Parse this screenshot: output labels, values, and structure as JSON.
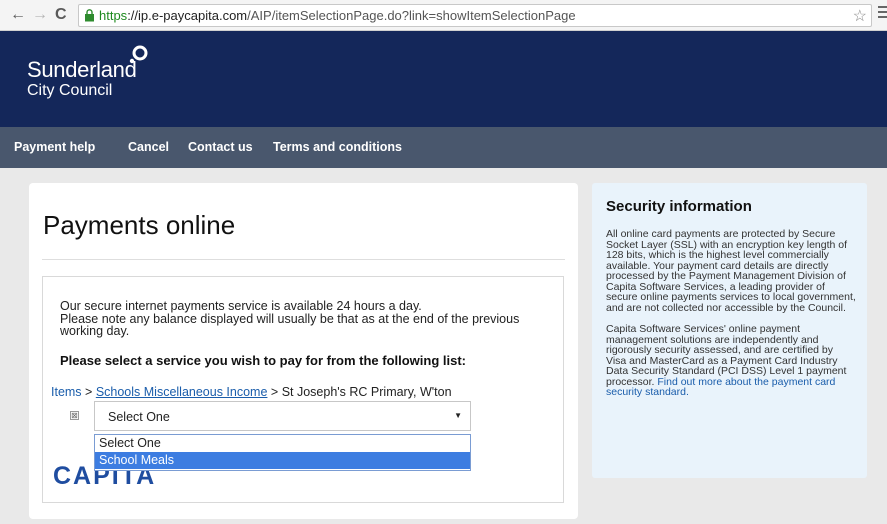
{
  "browser": {
    "back": "←",
    "forward": "→",
    "reload": "C",
    "url_scheme": "https",
    "url_host": "://ip.e-paycapita.com",
    "url_path": "/AIP/itemSelectionPage.do?link=showItemSelectionPage",
    "star": "☆"
  },
  "header": {
    "logo_line1": "Sunderland",
    "logo_line2": "City Council"
  },
  "nav": {
    "payment_help": "Payment help",
    "cancel": "Cancel",
    "contact_us": "Contact us",
    "terms": "Terms and conditions"
  },
  "main": {
    "title": "Payments online",
    "intro_line1": "Our secure internet payments service is available 24 hours a day.",
    "intro_line2": "Please note any balance displayed will usually be that as at the end of the previous working day.",
    "prompt": "Please select a service you wish to pay for from the following list:",
    "breadcrumb": {
      "items": "Items",
      "sep": " > ",
      "category": "Schools Miscellaneous Income",
      "current": "St Joseph's RC Primary, W'ton"
    },
    "expand_glyph": "⊠",
    "select": {
      "value": "Select One",
      "arrow": "▼",
      "options": [
        "Select One",
        "School Meals"
      ],
      "highlighted": "School Meals"
    },
    "capita": "CAPITA"
  },
  "security": {
    "title": "Security information",
    "para1": "All online card payments are protected by Secure Socket Layer (SSL) with an encryption key length of 128 bits, which is the highest level commercially available. Your payment card details are directly processed by the Payment Management Division of Capita Software Services, a leading provider of secure online payments services to local government, and are not collected nor accessible by the Council.",
    "para2": "Capita Software Services' online payment management solutions are independently and rigorously security assessed, and are certified by Visa and MasterCard as a Payment Card Industry Data Security Standard (PCI DSS) Level 1 payment processor.",
    "link": "Find out more about the payment card security standard."
  },
  "colors": {
    "header_bg": "#14275a",
    "nav_bg": "#49576d",
    "link": "#1a5dab",
    "dropdown_highlight": "#3d7de1",
    "security_bg": "#e9f3fb"
  }
}
